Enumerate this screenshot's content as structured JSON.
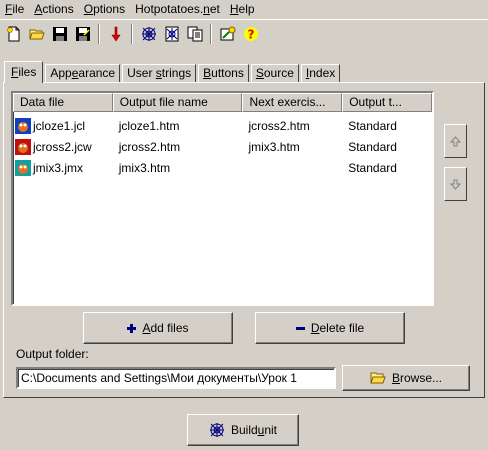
{
  "menu": {
    "items": [
      {
        "pre": "",
        "key": "F",
        "post": "ile"
      },
      {
        "pre": "",
        "key": "A",
        "post": "ctions"
      },
      {
        "pre": "",
        "key": "O",
        "post": "ptions"
      },
      {
        "pre": "Hotpotatoes.",
        "key": "n",
        "post": "et"
      },
      {
        "pre": "",
        "key": "H",
        "post": "elp"
      }
    ]
  },
  "toolbar": {
    "icons": [
      "new-file-icon",
      "open-folder-icon",
      "save-icon",
      "save-as-icon",
      "down-arrow-icon",
      "web-export-icon",
      "build-page-icon",
      "copy-pages-icon",
      "settings-icon",
      "help-icon"
    ]
  },
  "tabs": [
    {
      "pre": "",
      "key": "F",
      "post": "iles",
      "active": true
    },
    {
      "pre": "App",
      "key": "e",
      "post": "arance",
      "active": false
    },
    {
      "pre": "User ",
      "key": "s",
      "post": "trings",
      "active": false
    },
    {
      "pre": "",
      "key": "B",
      "post": "uttons",
      "active": false
    },
    {
      "pre": "",
      "key": "S",
      "post": "ource",
      "active": false
    },
    {
      "pre": "",
      "key": "I",
      "post": "ndex",
      "active": false
    }
  ],
  "table": {
    "columns": [
      "Data file",
      "Output file name",
      "Next exercis...",
      "Output t..."
    ],
    "rows": [
      {
        "icon": "jcloze-icon",
        "data_file": "jcloze1.jcl",
        "output": "jcloze1.htm",
        "next": "jcross2.htm",
        "type": "Standard"
      },
      {
        "icon": "jcross-icon",
        "data_file": "jcross2.jcw",
        "output": "jcross2.htm",
        "next": "jmix3.htm",
        "type": "Standard"
      },
      {
        "icon": "jmix-icon",
        "data_file": "jmix3.jmx",
        "output": "jmix3.htm",
        "next": "",
        "type": "Standard"
      }
    ]
  },
  "buttons": {
    "add_files": {
      "pre": "",
      "key": "A",
      "post": "dd files"
    },
    "delete_file": {
      "pre": "",
      "key": "D",
      "post": "elete file"
    },
    "browse": {
      "pre": "",
      "key": "B",
      "post": "rowse..."
    },
    "build_unit": {
      "pre": "Build ",
      "key": "u",
      "post": "nit"
    }
  },
  "output_folder": {
    "label": "Output folder:",
    "value": "C:\\Documents and Settings\\Мои документы\\Урок 1"
  },
  "colors": {
    "face": "#d4d0c8",
    "highlight": "#ffffff",
    "shadow": "#808080",
    "dark_shadow": "#404040",
    "accent_blue": "#000080"
  }
}
